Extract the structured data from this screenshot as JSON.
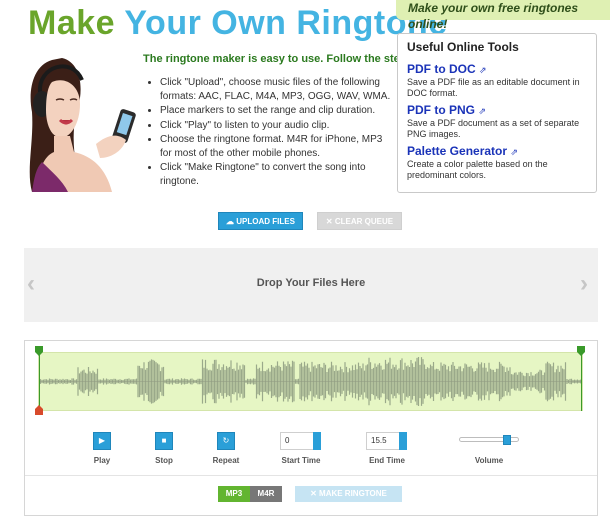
{
  "header": {
    "title_part1": "Make",
    "title_part2": "Your Own Ringtone",
    "tagline": "Make your own free ringtones online!"
  },
  "instructions": {
    "intro": "The ringtone maker is easy to use. Follow the steps:",
    "steps": [
      "Click \"Upload\", choose music files of the following formats: AAC, FLAC, M4A, MP3, OGG, WAV, WMA.",
      "Place markers to set the range and clip duration.",
      "Click \"Play\" to listen to your audio clip.",
      "Choose the ringtone format. M4R for iPhone, MP3 for most of the other mobile phones.",
      "Click \"Make Ringtone\" to convert the song into ringtone."
    ]
  },
  "tools": {
    "heading": "Useful Online Tools",
    "items": [
      {
        "name": "PDF to DOC",
        "desc": "Save a PDF file as an editable document in DOC format."
      },
      {
        "name": "PDF to PNG",
        "desc": "Save a PDF document as a set of separate PNG images."
      },
      {
        "name": "Palette Generator",
        "desc": "Create a color palette based on the predominant colors."
      }
    ]
  },
  "upload": {
    "upload_label": "UPLOAD FILES",
    "clear_label": "CLEAR QUEUE",
    "drop_text": "Drop Your Files Here",
    "prev_arrow": "‹",
    "next_arrow": "›"
  },
  "controls": {
    "play_label": "Play",
    "stop_label": "Stop",
    "repeat_label": "Repeat",
    "start_time_label": "Start Time",
    "start_time_value": "0",
    "end_time_label": "End Time",
    "end_time_value": "15.5",
    "volume_label": "Volume",
    "volume_level": 0.78
  },
  "export": {
    "format_mp3": "MP3",
    "format_m4r": "M4R",
    "selected_format": "MP3",
    "make_label": "MAKE RINGTONE"
  },
  "colors": {
    "accent_blue": "#2a9fd8",
    "accent_green": "#62b530",
    "waveform": "#9aa98a",
    "wave_bg": "#e6f6c4"
  },
  "icons": {
    "upload": "upload-icon",
    "clear": "close-icon",
    "play": "play-icon",
    "stop": "stop-icon",
    "repeat": "repeat-icon",
    "external": "external-link-icon",
    "make": "close-icon"
  }
}
